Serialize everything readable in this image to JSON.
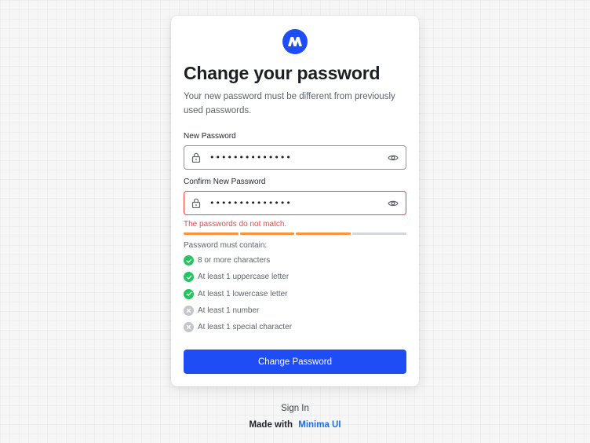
{
  "colors": {
    "accent": "#1f4df5",
    "error": "#ef4444",
    "success": "#22c55e",
    "strength_active": "#fb923c",
    "strength_inactive": "#d3d6da",
    "link": "#1f6fe5"
  },
  "logo": {
    "icon": "brand-m-logo"
  },
  "heading": {
    "title": "Change your password",
    "subtitle": "Your new password must be different from previously used passwords."
  },
  "form": {
    "new_password": {
      "label": "New Password",
      "value": "••••••••••••••",
      "icon": "lock-icon",
      "toggle_icon": "eye-icon"
    },
    "confirm_password": {
      "label": "Confirm New Password",
      "value": "••••••••••••••",
      "icon": "lock-icon",
      "toggle_icon": "eye-icon",
      "error": "The passwords do not match."
    },
    "strength": {
      "segments": 4,
      "filled": 3
    },
    "requirements": {
      "title": "Password must contain:",
      "items": [
        {
          "text": "8 or more characters",
          "met": true
        },
        {
          "text": "At least 1 uppercase letter",
          "met": true
        },
        {
          "text": "At least 1 lowercase letter",
          "met": true
        },
        {
          "text": "At least 1 number",
          "met": false
        },
        {
          "text": "At least 1 special character",
          "met": false
        }
      ]
    },
    "submit_label": "Change Password"
  },
  "links": {
    "sign_in": "Sign In"
  },
  "footer": {
    "made_with": "Made with",
    "brand": "Minima UI"
  }
}
